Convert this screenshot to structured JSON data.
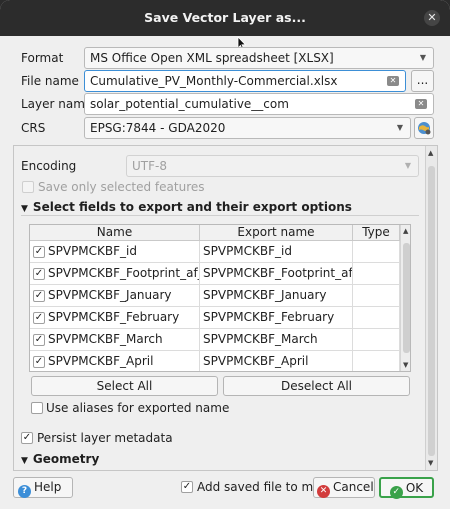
{
  "window": {
    "title": "Save Vector Layer as..."
  },
  "form": {
    "format_label": "Format",
    "format_value": "MS Office Open XML spreadsheet [XLSX]",
    "filename_label": "File name",
    "filename_value": "Cumulative_PV_Monthly-Commercial.xlsx",
    "browse_label": "...",
    "layername_label": "Layer name",
    "layername_value": "solar_potential_cumulative__com",
    "crs_label": "CRS",
    "crs_value": "EPSG:7844 - GDA2020"
  },
  "options": {
    "encoding_label": "Encoding",
    "encoding_value": "UTF-8",
    "save_selected_label": "Save only selected features",
    "fields_section_label": "Select fields to export and their export options",
    "columns": [
      "Name",
      "Export name",
      "Type"
    ],
    "rows": [
      {
        "name": "SPVPMCKBF_id",
        "export": "SPVPMCKBF_id",
        "type": "",
        "checked": true
      },
      {
        "name": "SPVPMCKBF_Footprint_af_id",
        "export": "SPVPMCKBF_Footprint_af_id",
        "type": "",
        "checked": true
      },
      {
        "name": "SPVPMCKBF_January",
        "export": "SPVPMCKBF_January",
        "type": "",
        "checked": true
      },
      {
        "name": "SPVPMCKBF_February",
        "export": "SPVPMCKBF_February",
        "type": "",
        "checked": true
      },
      {
        "name": "SPVPMCKBF_March",
        "export": "SPVPMCKBF_March",
        "type": "",
        "checked": true
      },
      {
        "name": "SPVPMCKBF_April",
        "export": "SPVPMCKBF_April",
        "type": "",
        "checked": true
      }
    ],
    "select_all_label": "Select All",
    "deselect_all_label": "Deselect All",
    "aliases_label": "Use aliases for exported name",
    "persist_label": "Persist layer metadata",
    "geometry_section_label": "Geometry"
  },
  "footer": {
    "help_label": "Help",
    "add_to_map_label": "Add saved file to map",
    "cancel_label": "Cancel",
    "ok_label": "OK"
  },
  "colors": {
    "titlebar": "#2c2c2c",
    "help_icon": "#3b8ed8",
    "cancel_icon": "#d23c3c",
    "ok_icon": "#3aa24a",
    "ok_border": "#3aa24a"
  }
}
